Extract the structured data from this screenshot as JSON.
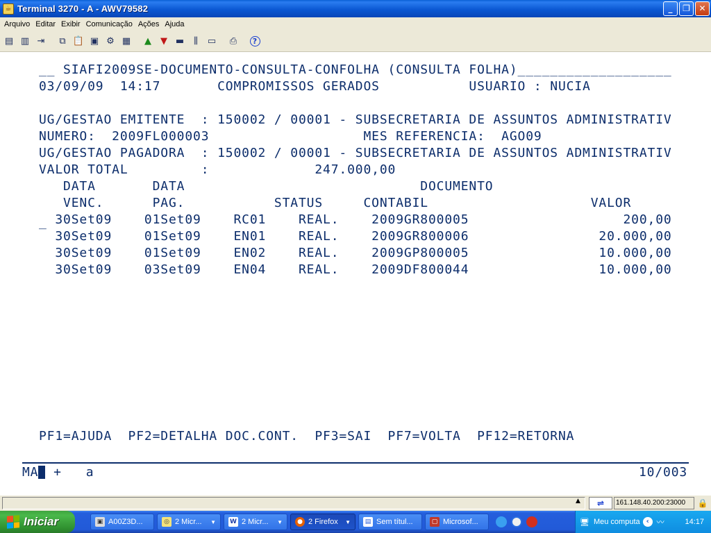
{
  "window": {
    "title": "Terminal 3270 - A - AWV79582",
    "app_icon": "java-icon",
    "controls": {
      "minimize": "_",
      "restore": "❐",
      "close": "✕"
    }
  },
  "menu": [
    "Arquivo",
    "Editar",
    "Exibir",
    "Comunicação",
    "Ações",
    "Ajuda"
  ],
  "toolbar": {
    "icons": [
      "copy-screen-icon",
      "print-screen-icon",
      "exit-icon",
      "copy-icon",
      "paste-icon",
      "paste-append-icon",
      "settings-icon",
      "keypad-icon",
      "send-file-icon",
      "receive-file-icon",
      "record-macro-icon",
      "play-macro-icon",
      "stop-icon",
      "display-icon",
      "help-icon"
    ]
  },
  "terminal": {
    "line1": "__ SIAFI2009SE-DOCUMENTO-CONSULTA-CONFOLHA (CONSULTA FOLHA)___________________",
    "line2": "03/09/09  14:17       COMPROMISSOS GERADOS           USUARIO : NUCIA",
    "ug_emitente": "UG/GESTAO EMITENTE  : 150002 / 00001 - SUBSECRETARIA DE ASSUNTOS ADMINISTRATIV",
    "numero": "NUMERO:  2009FL000003                   MES REFERENCIA:  AGO09",
    "ug_pagadora": "UG/GESTAO PAGADORA  : 150002 / 00001 - SUBSECRETARIA DE ASSUNTOS ADMINISTRATIV",
    "valor_total": "VALOR TOTAL         :             247.000,00",
    "header1": "   DATA       DATA                             DOCUMENTO",
    "header2": "   VENC.      PAG.           STATUS     CONTABIL                    VALOR",
    "rows": [
      "  30Set09    01Set09    RC01    REAL.    2009GR800005                   200,00",
      "  30Set09    01Set09    EN01    REAL.    2009GR800006                20.000,00",
      "  30Set09    01Set09    EN02    REAL.    2009GP800005                10.000,00",
      "  30Set09    03Set09    EN04    REAL.    2009DF800044                10.000,00"
    ],
    "field_cursor": "_",
    "pf_keys": "PF1=AJUDA  PF2=DETALHA DOC.CONT.  PF3=SAI  PF7=VOLTA  PF12=RETORNA",
    "oia_left": "MA",
    "oia_cursor_char": "A",
    "oia_indicators": "+   a",
    "oia_position": "10/003"
  },
  "statusbar": {
    "message": "",
    "host": "161.148.40.200:23000"
  },
  "taskbar": {
    "start_label": "Iniciar",
    "buttons": [
      {
        "label": "A00Z3D...",
        "icon": "terminal-icon",
        "active": false,
        "group": false
      },
      {
        "label": "2 Micr...",
        "icon": "app-icon",
        "active": false,
        "group": true
      },
      {
        "label": "2 Micr...",
        "icon": "word-icon",
        "active": false,
        "group": true
      },
      {
        "label": "2 Firefox",
        "icon": "firefox-icon",
        "active": true,
        "group": true
      },
      {
        "label": "Sem títul...",
        "icon": "document-icon",
        "active": false,
        "group": false
      },
      {
        "label": "Microsof...",
        "icon": "window-icon",
        "active": false,
        "group": false
      }
    ],
    "tray_label": "Meu computa",
    "clock": "14:17"
  }
}
